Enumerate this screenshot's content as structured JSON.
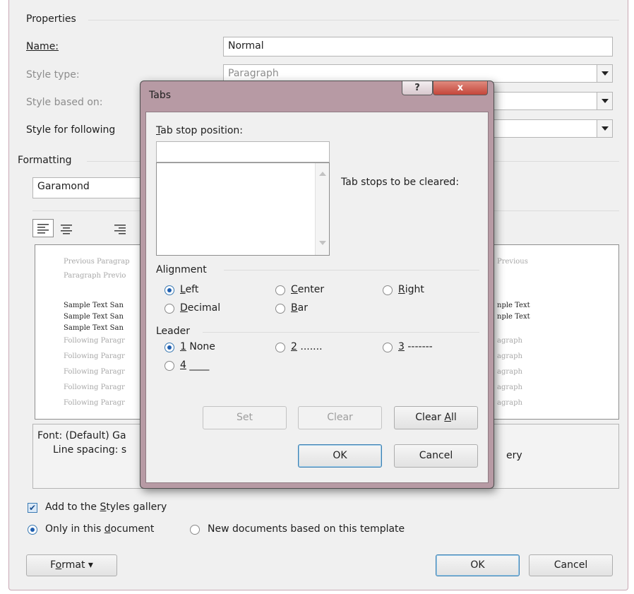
{
  "outer": {
    "properties_heading": "Properties",
    "name_label": "Name:",
    "name_value": "Normal",
    "style_type_label": "Style type:",
    "style_type_value": "Paragraph",
    "style_based_on_label": "Style based on:",
    "style_following_label": "Style for following",
    "formatting_heading": "Formatting",
    "font_value": "Garamond",
    "preview": {
      "previous_line1": "Previous Paragrap",
      "previous_line2": "Paragraph Previo",
      "previous_right": "Previous",
      "sample_lines": [
        "Sample Text San",
        "Sample Text San",
        "Sample Text San"
      ],
      "sample_right": [
        "nple Text",
        "nple Text"
      ],
      "following_lines": [
        "Following Paragr",
        "Following Paragr",
        "Following Paragr",
        "Following Paragr",
        "Following Paragr"
      ],
      "following_right": [
        "agraph",
        "agraph",
        "agraph",
        "agraph",
        "agraph"
      ]
    },
    "description_line1": "Font: (Default) Ga",
    "description_line2": "Line spacing:  s",
    "description_right": "ery",
    "add_to_gallery_pre": "Add to the ",
    "add_to_gallery_ul": "S",
    "add_to_gallery_post": "tyles gallery",
    "only_doc_pre": "Only in this ",
    "only_doc_ul": "d",
    "only_doc_post": "ocument",
    "new_docs_label": "New documents based on this template",
    "format_pre": "F",
    "format_ul": "o",
    "format_post": "rmat",
    "format_arrow": "▾",
    "ok_label": "OK",
    "cancel_label": "Cancel"
  },
  "tabs_dialog": {
    "title": "Tabs",
    "help_glyph": "?",
    "close_glyph": "x",
    "tab_stop_label_ul": "T",
    "tab_stop_label_post": "ab stop position:",
    "tab_stop_value": "",
    "tab_stops_cleared_label": "Tab stops to be cleared:",
    "alignment_heading": "Alignment",
    "alignment_options": [
      {
        "ul": "L",
        "rest": "eft",
        "selected": true
      },
      {
        "ul": "C",
        "rest": "enter",
        "selected": false
      },
      {
        "ul": "R",
        "rest": "ight",
        "selected": false
      },
      {
        "ul": "D",
        "rest": "ecimal",
        "selected": false
      },
      {
        "ul": "B",
        "rest": "ar",
        "selected": false
      }
    ],
    "leader_heading": "Leader",
    "leader_options": [
      {
        "ul": "1",
        "rest": " None",
        "selected": true
      },
      {
        "ul": "2",
        "rest": " .......",
        "selected": false
      },
      {
        "ul": "3",
        "rest": " -------",
        "selected": false
      },
      {
        "ul": "4",
        "rest": " ____",
        "selected": false
      }
    ],
    "set_label": "Set",
    "clear_label": "Clear",
    "clear_all_pre": "Clear ",
    "clear_all_ul": "A",
    "clear_all_post": "ll",
    "ok_label": "OK",
    "cancel_label": "Cancel",
    "close_button_color": "#c4463a"
  }
}
